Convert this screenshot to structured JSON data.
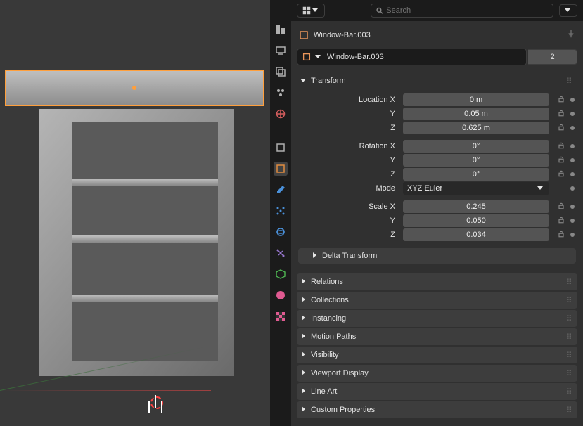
{
  "search": {
    "placeholder": "Search"
  },
  "breadcrumb": {
    "object": "Window-Bar.003"
  },
  "datablock": {
    "name": "Window-Bar.003",
    "users": "2"
  },
  "transform": {
    "title": "Transform",
    "location": {
      "label": "Location X",
      "x": "0 m",
      "y_label": "Y",
      "y": "0.05 m",
      "z_label": "Z",
      "z": "0.625 m"
    },
    "rotation": {
      "label": "Rotation X",
      "x": "0°",
      "y_label": "Y",
      "y": "0°",
      "z_label": "Z",
      "z": "0°"
    },
    "mode": {
      "label": "Mode",
      "value": "XYZ Euler"
    },
    "scale": {
      "label": "Scale X",
      "x": "0.245",
      "y_label": "Y",
      "y": "0.050",
      "z_label": "Z",
      "z": "0.034"
    },
    "delta": "Delta Transform"
  },
  "panels": {
    "relations": "Relations",
    "collections": "Collections",
    "instancing": "Instancing",
    "motion_paths": "Motion Paths",
    "visibility": "Visibility",
    "viewport_display": "Viewport Display",
    "line_art": "Line Art",
    "custom_properties": "Custom Properties"
  }
}
